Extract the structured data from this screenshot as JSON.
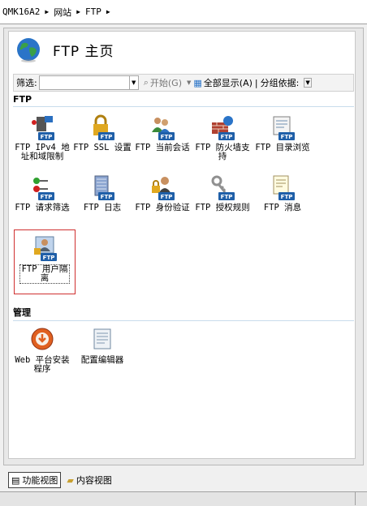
{
  "breadcrumb": {
    "server": "QMK16A2",
    "site": "网站",
    "ftp": "FTP"
  },
  "header": {
    "title": "FTP  主页"
  },
  "filter": {
    "label": "筛选:",
    "start": "开始(G)",
    "showAll": "全部显示(A)",
    "groupBy": "分组依据:"
  },
  "sections": {
    "ftp": "FTP",
    "manage": "管理"
  },
  "items": [
    {
      "label": "FTP IPv4 地址和域限制",
      "icon": "ftp-ip-restrict-icon"
    },
    {
      "label": "FTP SSL 设置",
      "icon": "ftp-ssl-lock-icon"
    },
    {
      "label": "FTP 当前会话",
      "icon": "ftp-sessions-users-icon"
    },
    {
      "label": "FTP 防火墙支持",
      "icon": "ftp-firewall-icon"
    },
    {
      "label": "FTP 目录浏览",
      "icon": "ftp-directory-browse-icon"
    },
    {
      "label": "FTP 请求筛选",
      "icon": "ftp-request-filter-icon"
    },
    {
      "label": "FTP 日志",
      "icon": "ftp-log-icon"
    },
    {
      "label": "FTP 身份验证",
      "icon": "ftp-authentication-icon"
    },
    {
      "label": "FTP 授权规则",
      "icon": "ftp-authorization-key-icon"
    },
    {
      "label": "FTP 消息",
      "icon": "ftp-messages-icon"
    },
    {
      "label": "FTP 用户隔离",
      "icon": "ftp-user-isolation-icon"
    },
    {
      "label": "Web 平台安装程序",
      "icon": "web-platform-installer-icon"
    },
    {
      "label": "配置编辑器",
      "icon": "configuration-editor-icon"
    }
  ],
  "tabs": {
    "features": "功能视图",
    "content": "内容视图"
  },
  "colors": {
    "selection": "#d03030",
    "badge": "#1f5fa8",
    "globe": "#2a74c8"
  }
}
